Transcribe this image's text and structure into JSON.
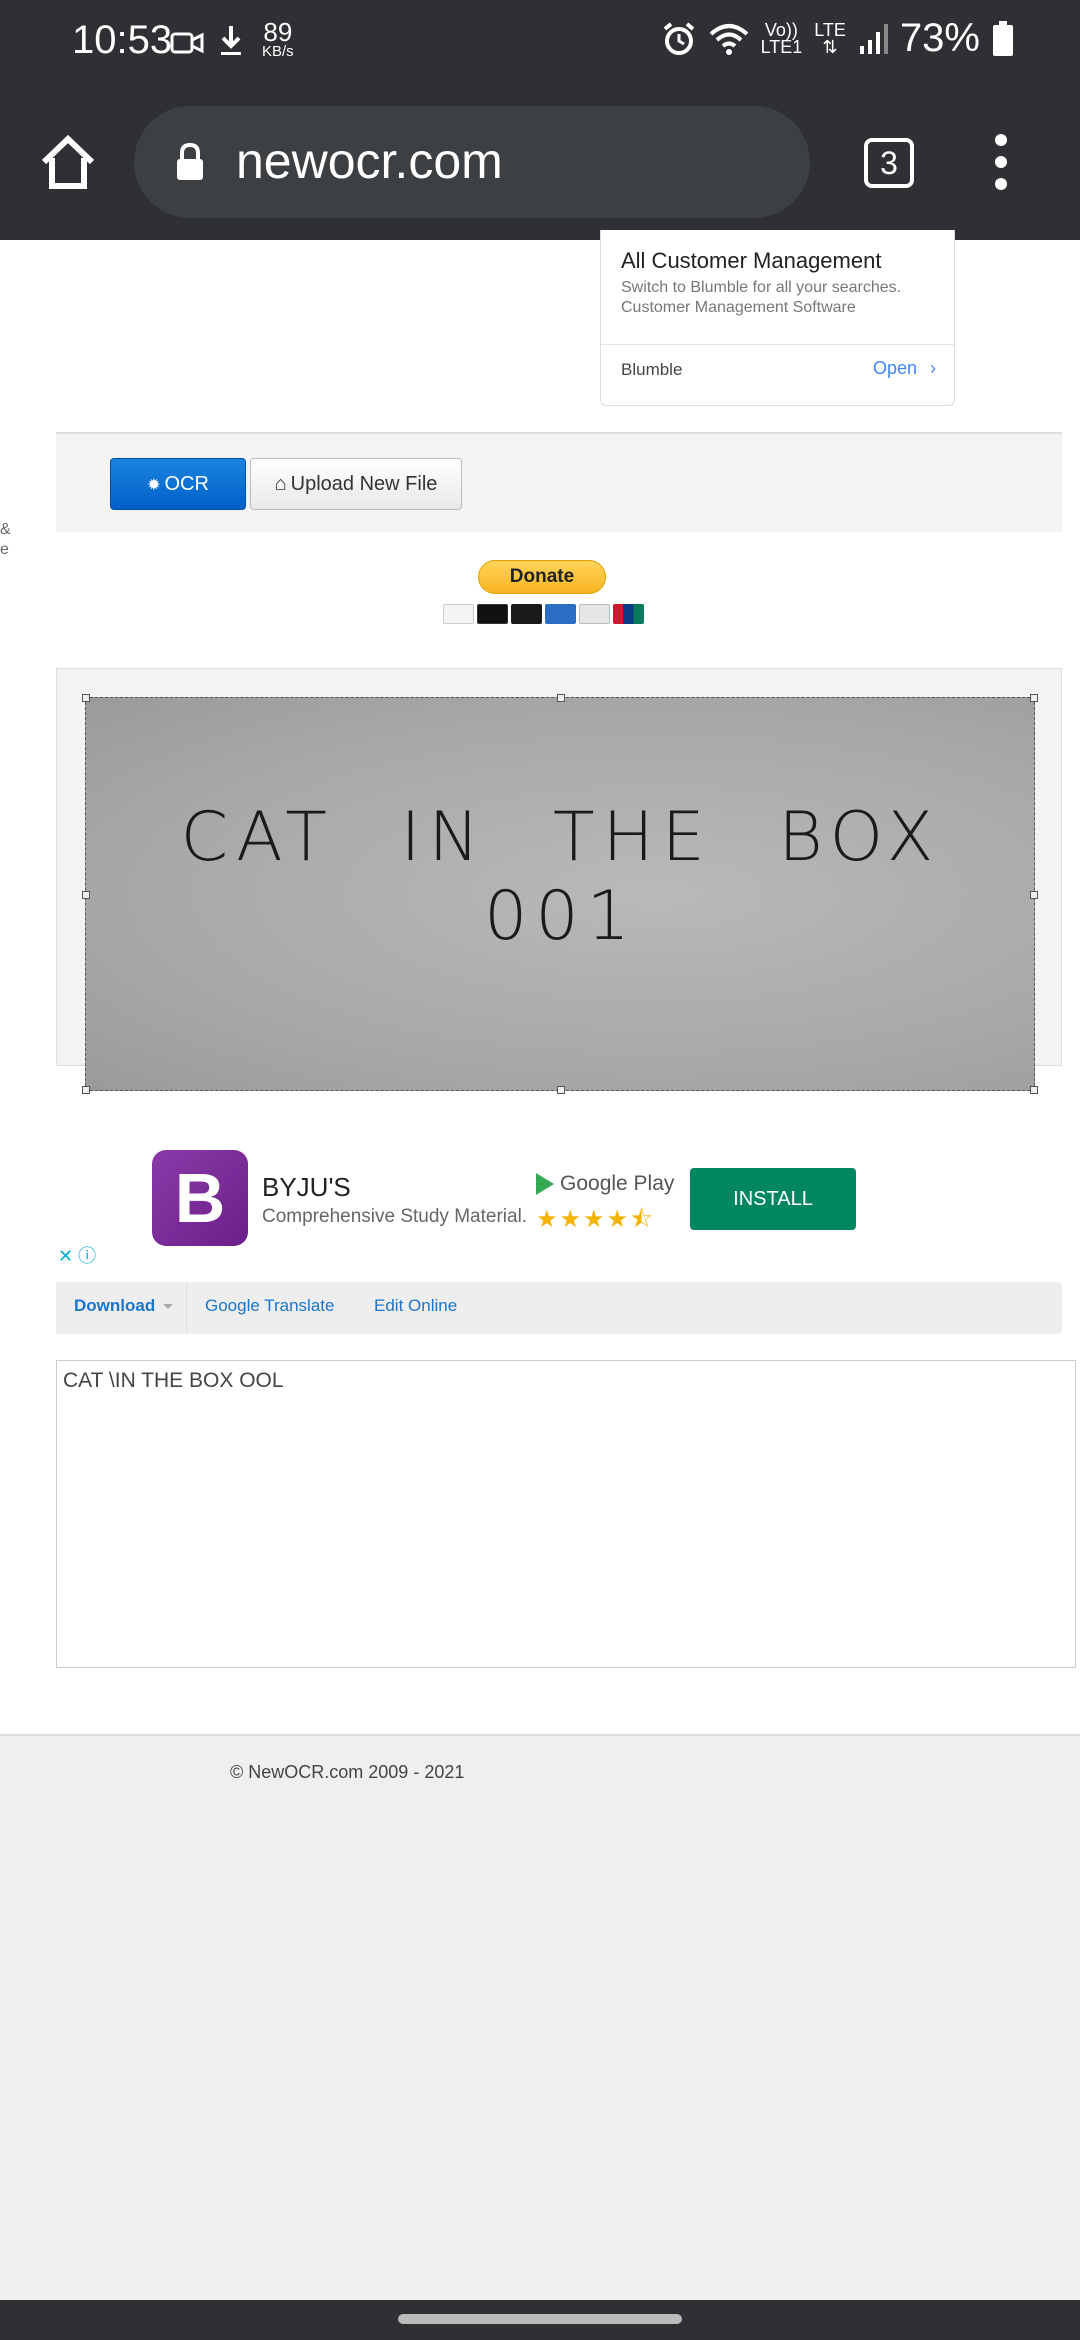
{
  "status_bar": {
    "time": "10:53",
    "speed_value": "89",
    "speed_unit": "KB/s",
    "volte": "Vo))",
    "lte1": "LTE1",
    "lte": "LTE",
    "battery": "73%",
    "icons": [
      "video-icon",
      "download-icon",
      "alarm-icon",
      "wifi-icon",
      "signal-icon",
      "battery-icon"
    ]
  },
  "browser": {
    "url": "newocr.com",
    "tab_count": "3"
  },
  "ad_card": {
    "title": "All Customer Management",
    "description": "Switch to Blumble for all your searches. Customer Management Software",
    "brand": "Blumble",
    "open_label": "Open"
  },
  "toolbar": {
    "ocr_label": "OCR",
    "upload_label": "Upload New File"
  },
  "side_text": [
    "&",
    "e"
  ],
  "donate": {
    "label": "Donate"
  },
  "image_preview": {
    "handwriting_text": "CAT IN THE BOX 001"
  },
  "app_ad": {
    "logo_letter": "B",
    "name": "BYJU'S",
    "description": "Comprehensive Study Material.",
    "store": "Google Play",
    "rating_stars": "★★★★⯪",
    "install_label": "INSTALL",
    "adchoice": "✕ ⓘ"
  },
  "result_bar": {
    "download_label": "Download",
    "translate_label": "Google Translate",
    "edit_label": "Edit Online"
  },
  "result": {
    "text": "CAT \\IN THE BOX OOL"
  },
  "footer": {
    "copyright": "© NewOCR.com 2009 - 2021"
  },
  "colors": {
    "chrome": "#2e3033",
    "ocr_button": "#0060c8",
    "install_button": "#01875f",
    "link": "#1c75c8"
  }
}
